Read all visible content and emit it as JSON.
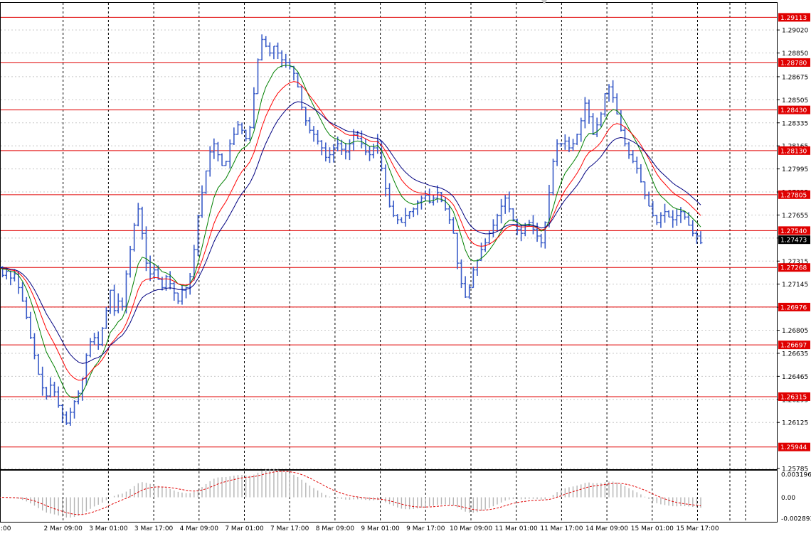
{
  "chart_data": {
    "type": "candlestick",
    "price_axis": {
      "ylim": [
        1.2578,
        1.2922
      ],
      "ticks": [
        "1.29020",
        "1.28850",
        "1.28675",
        "1.28505",
        "1.28335",
        "1.28165",
        "1.27995",
        "1.27825",
        "1.27655",
        "1.27485",
        "1.27315",
        "1.27145",
        "1.26975",
        "1.26805",
        "1.26635",
        "1.26465",
        "1.26295",
        "1.26125",
        "1.25785"
      ]
    },
    "time_axis": {
      "ticks": [
        ":00",
        "2 Mar 09:00",
        "3 Mar 01:00",
        "3 Mar 17:00",
        "4 Mar 09:00",
        "7 Mar 01:00",
        "7 Mar 17:00",
        "8 Mar 09:00",
        "9 Mar 01:00",
        "9 Mar 17:00",
        "10 Mar 09:00",
        "11 Mar 01:00",
        "11 Mar 17:00",
        "14 Mar 09:00",
        "15 Mar 01:00",
        "15 Mar 17:00"
      ]
    },
    "levels": [
      "1.29113",
      "1.28780",
      "1.28430",
      "1.28130",
      "1.27805",
      "1.27540",
      "1.27268",
      "1.26976",
      "1.26697",
      "1.26315",
      "1.25944"
    ],
    "current_price": "1.27473",
    "close_series": [
      1.2727,
      1.2721,
      1.2724,
      1.2719,
      1.2722,
      1.2712,
      1.2702,
      1.269,
      1.2675,
      1.2662,
      1.2648,
      1.2638,
      1.2632,
      1.264,
      1.2635,
      1.2625,
      1.2618,
      1.2612,
      1.262,
      1.2628,
      1.2634,
      1.2645,
      1.2662,
      1.2672,
      1.2675,
      1.267,
      1.2682,
      1.2695,
      1.271,
      1.2695,
      1.2702,
      1.2698,
      1.2722,
      1.274,
      1.2758,
      1.277,
      1.2752,
      1.273,
      1.2722,
      1.2725,
      1.2718,
      1.2712,
      1.272,
      1.2715,
      1.2708,
      1.2702,
      1.271,
      1.2712,
      1.272,
      1.274,
      1.2765,
      1.2782,
      1.2798,
      1.2812,
      1.2818,
      1.281,
      1.2802,
      1.2805,
      1.2818,
      1.2825,
      1.2832,
      1.2828,
      1.2822,
      1.283,
      1.2855,
      1.288,
      1.2895,
      1.289,
      1.2885,
      1.289,
      1.2885,
      1.288,
      1.2878,
      1.2875,
      1.287,
      1.286,
      1.2845,
      1.2835,
      1.2828,
      1.2825,
      1.282,
      1.2815,
      1.2808,
      1.281,
      1.2815,
      1.2818,
      1.2814,
      1.2812,
      1.2818,
      1.2825,
      1.2822,
      1.2818,
      1.2812,
      1.281,
      1.2815,
      1.282,
      1.28,
      1.2785,
      1.2772,
      1.2765,
      1.2762,
      1.276,
      1.2765,
      1.2768,
      1.277,
      1.2775,
      1.2778,
      1.278,
      1.2775,
      1.2778,
      1.2782,
      1.2776,
      1.277,
      1.2762,
      1.2752,
      1.273,
      1.2715,
      1.2705,
      1.2712,
      1.2725,
      1.2732,
      1.274,
      1.2745,
      1.2752,
      1.2758,
      1.2765,
      1.2772,
      1.2778,
      1.277,
      1.2762,
      1.2755,
      1.2752,
      1.2758,
      1.276,
      1.2755,
      1.275,
      1.2745,
      1.276,
      1.2782,
      1.2805,
      1.2818,
      1.2818,
      1.282,
      1.2815,
      1.2818,
      1.2825,
      1.2835,
      1.2848,
      1.2838,
      1.2825,
      1.2832,
      1.284,
      1.2855,
      1.286,
      1.2852,
      1.284,
      1.2828,
      1.2818,
      1.281,
      1.2805,
      1.28,
      1.279,
      1.278,
      1.2772,
      1.2765,
      1.276,
      1.2765,
      1.2768,
      1.2764,
      1.2762,
      1.2765,
      1.2768,
      1.2764,
      1.2758,
      1.2752,
      1.275,
      1.2745
    ],
    "moving_averages": [
      "green",
      "red",
      "navy"
    ],
    "oscillator": {
      "ticks": [
        "0.003196",
        "0.00",
        "-0.002893"
      ]
    }
  }
}
